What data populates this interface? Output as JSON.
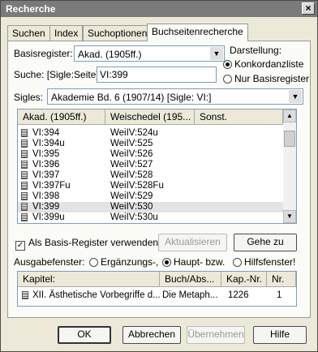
{
  "window": {
    "title": "Recherche",
    "close_glyph": "×"
  },
  "tabs": [
    {
      "label": "Suchen"
    },
    {
      "label": "Index"
    },
    {
      "label": "Suchoptionen"
    },
    {
      "label": "Buchseitenrecherche"
    }
  ],
  "form": {
    "basisregister_label": "Basisregister:",
    "basisregister_value": "Akad. (1905ff.)",
    "suche_label": "Suche: [Sigle:Seite]",
    "suche_value": "VI:399",
    "darstellung_label": "Darstellung:",
    "radio_konkordanz": "Konkordanzliste",
    "radio_basis": "Nur Basisregister",
    "sigles_label": "Sigles:",
    "sigles_value": "Akademie Bd. 6 (1907/14) [Sigle: VI:]"
  },
  "results": {
    "columns": [
      "Akad. (1905ff.)",
      "Weischedel (195...",
      "Sonst."
    ],
    "rows": [
      [
        "VI:394",
        "WeiIV:524u"
      ],
      [
        "VI:394u",
        "WeiIV:525"
      ],
      [
        "VI:395",
        "WeiIV:526"
      ],
      [
        "VI:396",
        "WeiIV:527"
      ],
      [
        "VI:397",
        "WeiIV:528"
      ],
      [
        "VI:397Fu",
        "WeiIV:528Fu"
      ],
      [
        "VI:398",
        "WeiIV:529"
      ],
      [
        "VI:399",
        "WeiIV:530"
      ],
      [
        "VI:399u",
        "WeiIV:530u"
      ]
    ],
    "selected_row": 7
  },
  "options": {
    "basis_checkbox": "Als Basis-Register verwenden!",
    "basis_checked": true,
    "aktualisieren": "Aktualisieren",
    "gehe_zu": "Gehe zu",
    "ausgabe_label": "Ausgabefenster:",
    "radio_ergaenzung": "Ergänzungs-,",
    "radio_haupt": "Haupt- bzw.",
    "radio_hilfs": "Hilfsfenster!"
  },
  "chapter": {
    "columns": [
      "Kapitel:",
      "Buch/Abs...",
      "Kap.-Nr.",
      "Nr."
    ],
    "row": [
      "XII. Ästhetische Vorbegriffe d...",
      "Die Metaph...",
      "1226",
      "1"
    ]
  },
  "buttons": {
    "ok": "OK",
    "abbrechen": "Abbrechen",
    "uebernehmen": "Übernehmen",
    "hilfe": "Hilfe"
  },
  "icons": {
    "combo_arrow": "▼",
    "scroll_up": "▲",
    "scroll_down": "▼",
    "check": "✓"
  }
}
